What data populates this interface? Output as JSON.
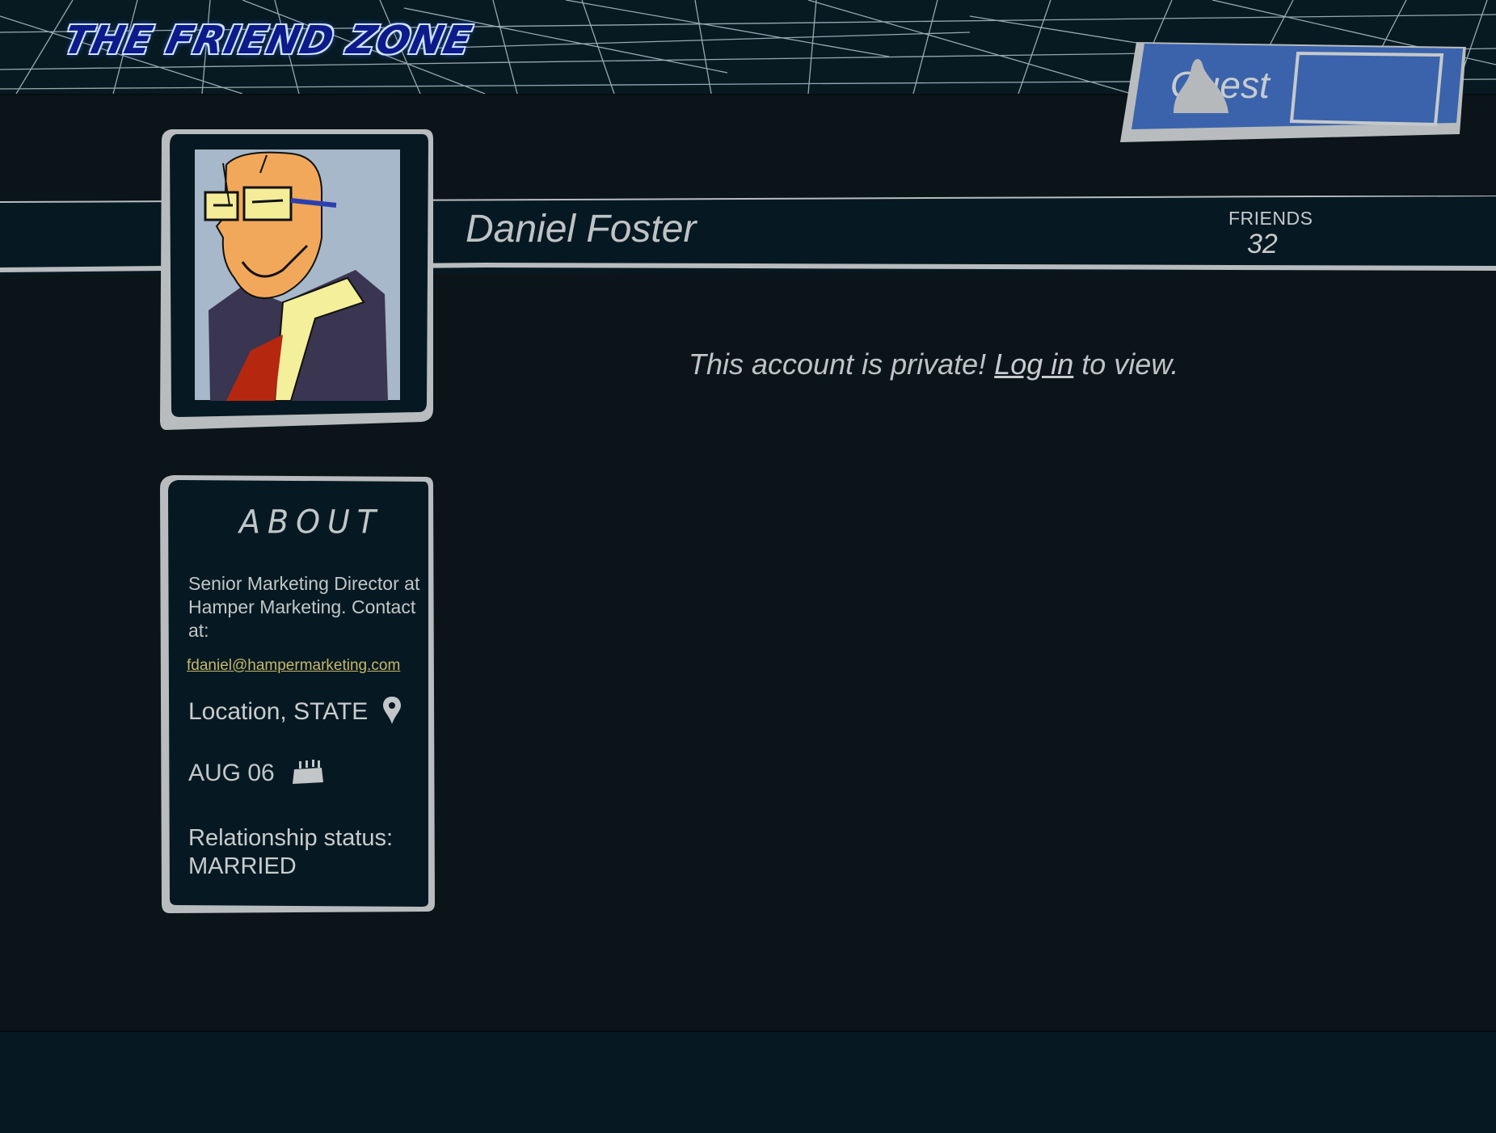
{
  "header": {
    "logo": "THE FRIEND ZONE",
    "user_label": "Guest"
  },
  "profile": {
    "name": "Daniel Foster",
    "friends_label": "FRIENDS",
    "friends_count": "32"
  },
  "privacy": {
    "message_before": "This account is private! ",
    "login_link": "Log in",
    "message_after": " to view."
  },
  "about": {
    "title": "ABOUT",
    "bio": "Senior Marketing Director at Hamper Marketing. Contact at:",
    "email": "fdaniel@hampermarketing.com",
    "location": "Location, STATE",
    "birthday": "AUG 06",
    "relationship_label": "Relationship status:",
    "relationship_value": "MARRIED"
  },
  "colors": {
    "background": "#0b1519",
    "header_bg": "#071a22",
    "guest_badge": "#3a63ac",
    "frame": "#b9bcbe",
    "email_link": "#c7b768"
  },
  "icons": {
    "location": "map-pin-icon",
    "birthday": "cake-icon",
    "guest_avatar": "user-silhouette-icon"
  }
}
